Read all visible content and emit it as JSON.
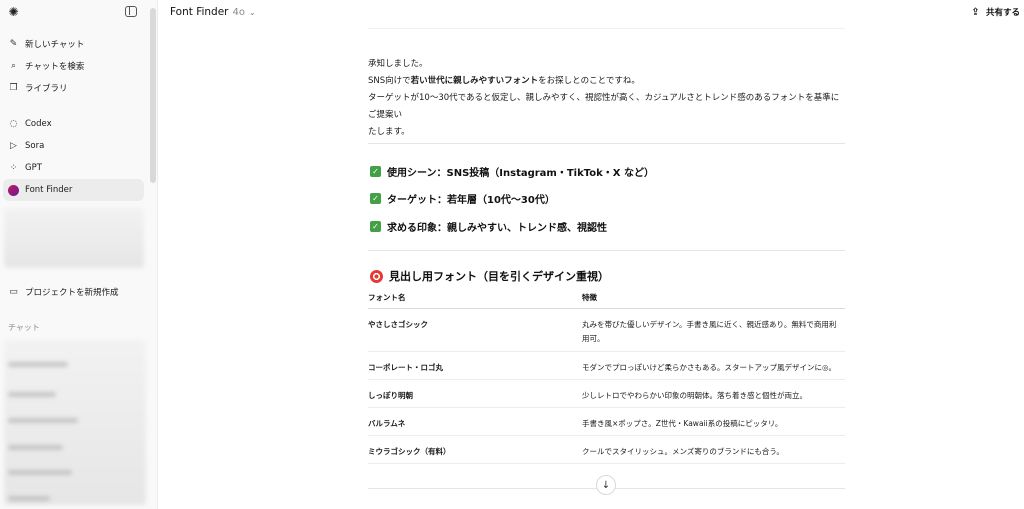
{
  "sidebar": {
    "items": [
      {
        "label": "新しいチャット",
        "icon": "new-chat-icon"
      },
      {
        "label": "チャットを検索",
        "icon": "search-icon"
      },
      {
        "label": "ライブラリ",
        "icon": "library-icon"
      },
      {
        "label": "Codex",
        "icon": "codex-icon"
      },
      {
        "label": "Sora",
        "icon": "sora-icon"
      },
      {
        "label": "GPT",
        "icon": "gpt-grid-icon"
      },
      {
        "label": "Font Finder",
        "icon": "font-finder-avatar"
      }
    ],
    "new_project_label": "プロジェクトを新規作成",
    "chats_section_label": "チャット"
  },
  "header": {
    "title": "Font Finder",
    "model_version": "4o",
    "share_label": "共有する"
  },
  "message": {
    "intro_line1": "承知しました。",
    "intro_line2_pre": "SNS向けで",
    "intro_line2_bold": "若い世代に親しみやすいフォント",
    "intro_line2_post": "をお探しとのことですね。",
    "intro_line3": "ターゲットが10～30代であると仮定し、親しみやすく、視認性が高く、カジュアルさとトレンド感のあるフォントを基準にご提案い",
    "intro_line4": "たします。",
    "checks": [
      "使用シーン：SNS投稿（Instagram・TikTok・X など）",
      "ターゲット：若年層（10代～30代）",
      "求める印象：親しみやすい、トレンド感、視認性"
    ],
    "section_heading": "見出し用フォント（目を引くデザイン重視）",
    "table": {
      "headers": [
        "フォント名",
        "特徴"
      ],
      "rows": [
        {
          "name": "やさしさゴシック",
          "desc1": "丸みを帯びた優しいデザイン。手書き風に近く、親近感あり。無料で商用利",
          "desc2": "用可。"
        },
        {
          "name": "コーポレート・ロゴ丸",
          "desc1": "モダンでプロっぽいけど柔らかさもある。スタートアップ風デザインに◎。",
          "desc2": ""
        },
        {
          "name": "しっぽり明朝",
          "desc1": "少しレトロでやわらかい印象の明朝体。落ち着き感と個性が両立。",
          "desc2": ""
        },
        {
          "name": "バルラムネ",
          "desc1": "手書き風×ポップさ。Z世代・Kawaii系の投稿にピッタリ。",
          "desc2": ""
        },
        {
          "name": "ミウラゴシック（有料）",
          "desc1": "クールでスタイリッシュ。メンズ寄りのブランドにも合う。",
          "desc2": ""
        }
      ]
    }
  },
  "colors": {
    "sidebar_bg": "#f9f9f9",
    "active_item_bg": "#ececec",
    "check_green": "#43a047",
    "target_red": "#e53935"
  }
}
